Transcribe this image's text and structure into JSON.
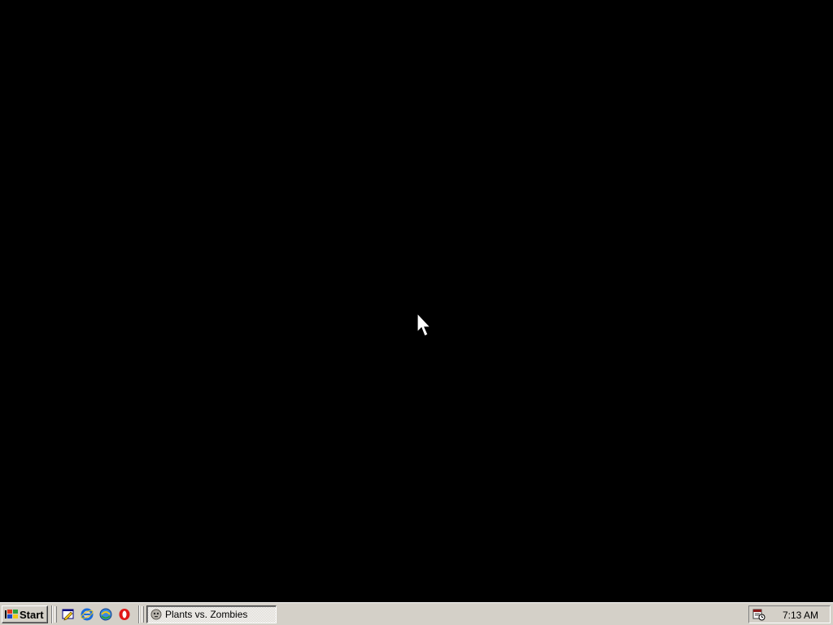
{
  "desktop": {
    "background_color": "#000000"
  },
  "cursor": {
    "icon": "arrow-cursor-icon"
  },
  "taskbar": {
    "start_label": "Start",
    "quick_launch": [
      {
        "icon": "show-desktop-icon"
      },
      {
        "icon": "internet-explorer-icon"
      },
      {
        "icon": "windows-update-icon"
      },
      {
        "icon": "opera-icon"
      }
    ],
    "tasks": [
      {
        "label": "Plants vs. Zombies",
        "icon": "plants-vs-zombies-icon"
      }
    ],
    "tray": {
      "icons": [
        {
          "icon": "task-scheduler-icon"
        }
      ],
      "clock": "7:13 AM"
    },
    "colors": {
      "face": "#d4d0c8",
      "highlight": "#ffffff",
      "shadow": "#808080"
    }
  }
}
